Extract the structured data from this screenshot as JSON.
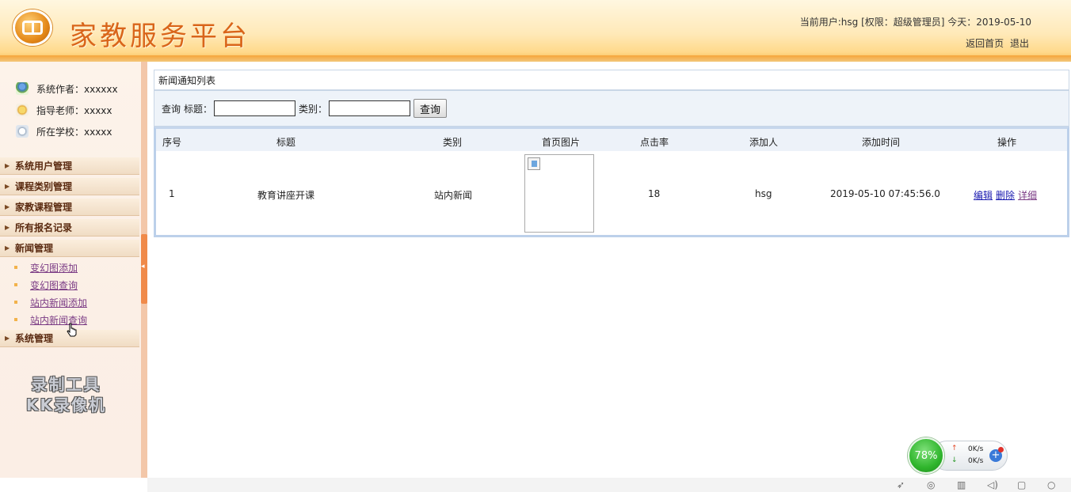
{
  "header": {
    "title": "家教服务平台",
    "user_info": "当前用户:hsg [权限：超级管理员] 今天：2019-05-10",
    "links": [
      "返回首页",
      "退出"
    ]
  },
  "sidebar": {
    "info": [
      {
        "label": "系统作者：xxxxxx",
        "icon": "user-icon"
      },
      {
        "label": "指导老师：xxxxx",
        "icon": "teacher-icon"
      },
      {
        "label": "所在学校：xxxxx",
        "icon": "school-icon"
      }
    ],
    "menus": [
      "系统用户管理",
      "课程类别管理",
      "家教课程管理",
      "所有报名记录",
      "新闻管理",
      "系统管理"
    ],
    "submenu": [
      "变幻图添加",
      "变幻图查询",
      "站内新闻添加",
      "站内新闻查询"
    ],
    "watermark": [
      "录制工具",
      "KK录像机"
    ]
  },
  "main": {
    "panel_title": "新闻通知列表",
    "search": {
      "query_label": "查询",
      "title_label": "标题：",
      "title_value": "",
      "category_label": "类别：",
      "category_value": "",
      "button": "查询"
    },
    "table": {
      "headers": [
        "序号",
        "标题",
        "类别",
        "首页图片",
        "点击率",
        "添加人",
        "添加时间",
        "操作"
      ],
      "rows": [
        {
          "no": "1",
          "title": "教育讲座开课",
          "category": "站内新闻",
          "clicks": "18",
          "added_by": "hsg",
          "added_time": "2019-05-10 07:45:56.0",
          "ops": [
            "编辑",
            "删除",
            "详细"
          ]
        }
      ]
    }
  },
  "widget": {
    "percent": "78%",
    "upload": "0K/s",
    "download": "0K/s"
  },
  "colors": {
    "title": "#d9651a",
    "header_band": "#f6a53a",
    "sidebar_bg": "#fdf3ea",
    "table_border": "#bcd0ea"
  }
}
